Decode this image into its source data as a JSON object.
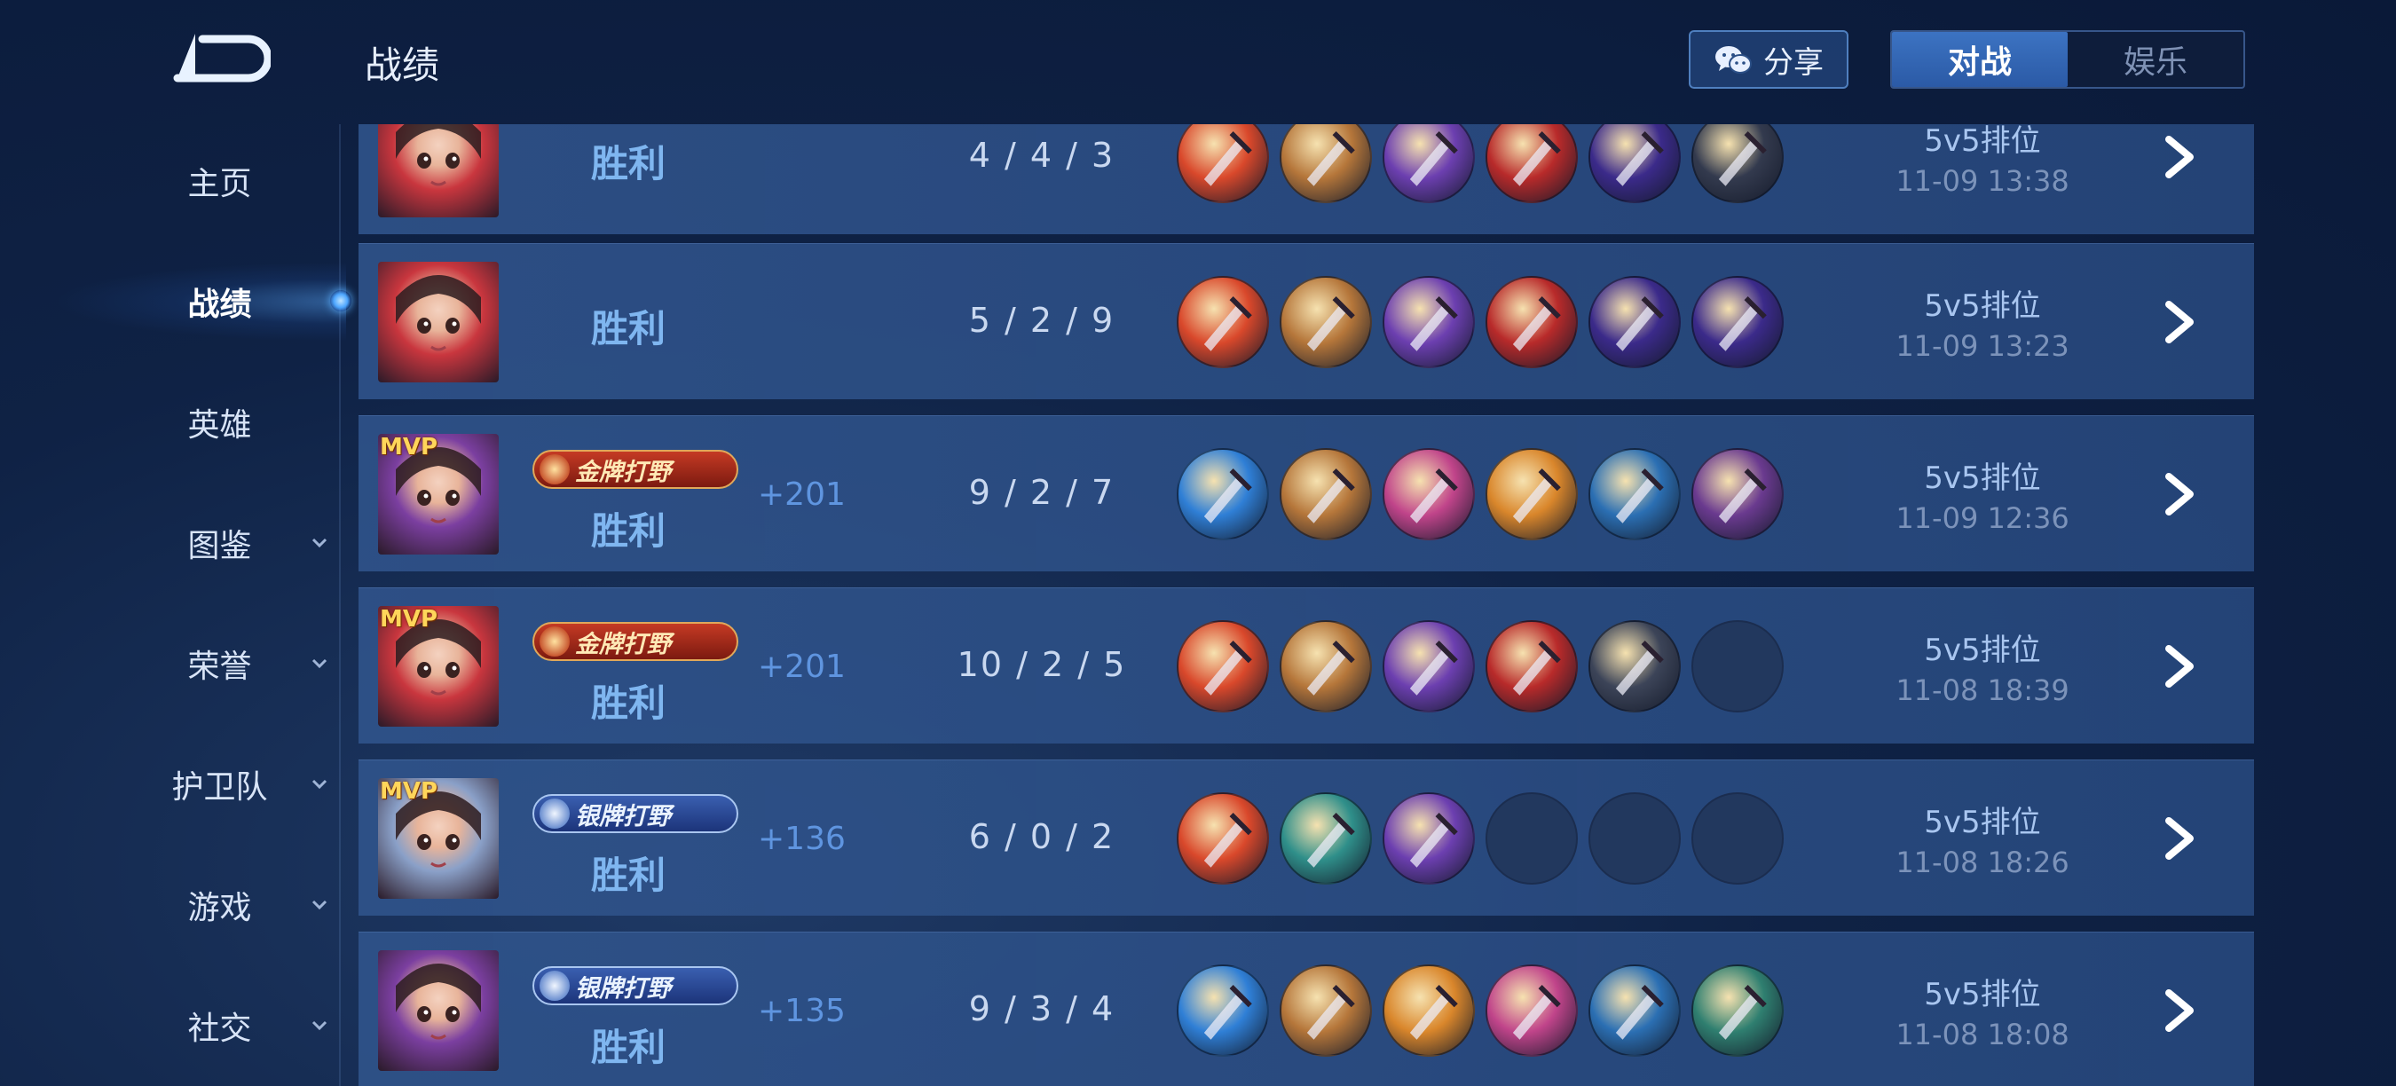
{
  "header": {
    "title": "战绩",
    "share_label": "分享",
    "tabs": [
      "对战",
      "娱乐"
    ],
    "active_tab": 0
  },
  "sidebar": {
    "items": [
      {
        "label": "主页",
        "has_chevron": false
      },
      {
        "label": "战绩",
        "has_chevron": false,
        "active": true
      },
      {
        "label": "英雄",
        "has_chevron": false
      },
      {
        "label": "图鉴",
        "has_chevron": true
      },
      {
        "label": "荣誉",
        "has_chevron": true
      },
      {
        "label": "护卫队",
        "has_chevron": true
      },
      {
        "label": "游戏",
        "has_chevron": true
      },
      {
        "label": "社交",
        "has_chevron": true
      }
    ]
  },
  "matches": [
    {
      "result": "胜利",
      "mvp": false,
      "badge": null,
      "badge_type": null,
      "points": "",
      "kda": "4 / 4 / 3",
      "mode": "5v5排位",
      "time": "11-09  13:38",
      "hero_color": "#c9363e",
      "items": [
        "#d9482b",
        "#b5763a",
        "#6c3fb0",
        "#b82a2a",
        "#3b2a8a",
        "#333a4e"
      ]
    },
    {
      "result": "胜利",
      "mvp": false,
      "badge": null,
      "badge_type": null,
      "points": "",
      "kda": "5 / 2 / 9",
      "mode": "5v5排位",
      "time": "11-09  13:23",
      "hero_color": "#c9363e",
      "items": [
        "#d9482b",
        "#b5763a",
        "#6c3fb0",
        "#b82a2a",
        "#3b2a8a",
        "#3b2a8a"
      ]
    },
    {
      "result": "胜利",
      "mvp": true,
      "mvp_label": "MVP",
      "badge": "金牌打野",
      "badge_type": "gold",
      "points": "+201",
      "kda": "9 / 2 / 7",
      "mode": "5v5排位",
      "time": "11-09  12:36",
      "hero_color": "#7b3fa0",
      "items": [
        "#2f7fd6",
        "#b5763a",
        "#c0448a",
        "#d9862b",
        "#2b6fb3",
        "#6a3a8f"
      ]
    },
    {
      "result": "胜利",
      "mvp": true,
      "mvp_label": "MVP",
      "badge": "金牌打野",
      "badge_type": "gold",
      "points": "+201",
      "kda": "10 / 2 / 5",
      "mode": "5v5排位",
      "time": "11-08  18:39",
      "hero_color": "#c9363e",
      "items": [
        "#d9482b",
        "#b5763a",
        "#6c3fb0",
        "#b82a2a",
        "#3c4458",
        null
      ]
    },
    {
      "result": "胜利",
      "mvp": true,
      "mvp_label": "MVP",
      "badge": "银牌打野",
      "badge_type": "silver",
      "points": "+136",
      "kda": "6 / 0 / 2",
      "mode": "5v5排位",
      "time": "11-08  18:26",
      "hero_color": "#8aa0c8",
      "items": [
        "#d9482b",
        "#2f8f8a",
        "#6c3fb0",
        null,
        null,
        null
      ]
    },
    {
      "result": "胜利",
      "mvp": false,
      "badge": "银牌打野",
      "badge_type": "silver",
      "points": "+135",
      "kda": "9 / 3 / 4",
      "mode": "5v5排位",
      "time": "11-08  18:08",
      "hero_color": "#7b3fa0",
      "items": [
        "#2f7fd6",
        "#b5763a",
        "#d9862b",
        "#c0448a",
        "#2b6fb3",
        "#2f7f70"
      ]
    }
  ]
}
